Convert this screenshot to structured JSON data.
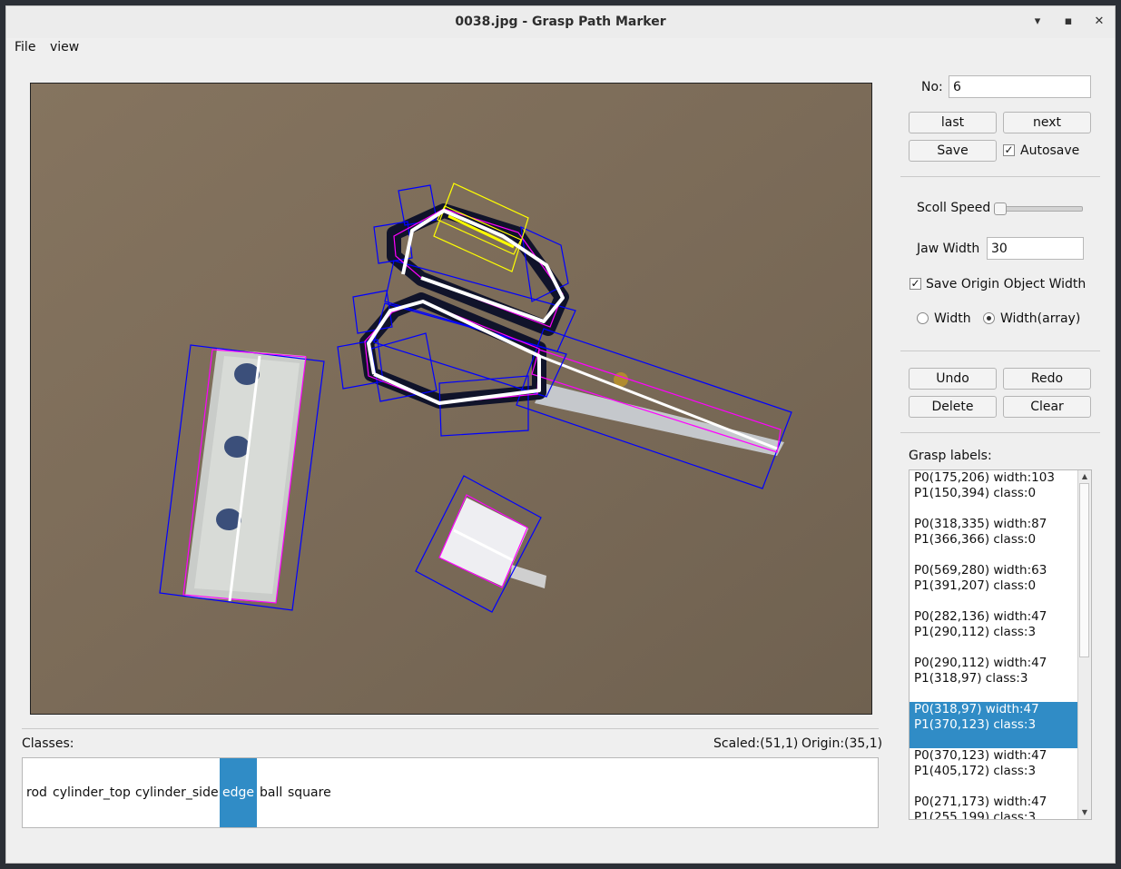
{
  "window": {
    "title": "0038.jpg - Grasp Path Marker",
    "minimize": "▾",
    "maximize": "▪",
    "close": "✕"
  },
  "menu": {
    "file": "File",
    "view": "view"
  },
  "controls": {
    "no_label": "No:",
    "no_value": "6",
    "last": "last",
    "next": "next",
    "save": "Save",
    "autosave": "Autosave",
    "autosave_checked": true,
    "scroll_speed": "Scoll Speed",
    "jaw_width_label": "Jaw Width",
    "jaw_width_value": "30",
    "save_origin": "Save Origin Object Width",
    "save_origin_checked": true,
    "width": "Width",
    "width_array": "Width(array)",
    "width_mode": "Width(array)",
    "undo": "Undo",
    "redo": "Redo",
    "delete": "Delete",
    "clear": "Clear"
  },
  "status": {
    "classes_label": "Classes:",
    "scaled": "Scaled:(51,1)",
    "origin": "Origin:(35,1)"
  },
  "classes": [
    "rod",
    "cylinder_top",
    "cylinder_side",
    "edge",
    "ball",
    "square"
  ],
  "selected_class": "edge",
  "grasp_labels_title": "Grasp labels:",
  "grasp_labels": [
    {
      "line1": "P0(175,206) width:103",
      "line2": "P1(150,394) class:0"
    },
    {
      "line1": "P0(318,335) width:87",
      "line2": "P1(366,366) class:0"
    },
    {
      "line1": "P0(569,280) width:63",
      "line2": "P1(391,207) class:0"
    },
    {
      "line1": "P0(282,136) width:47",
      "line2": "P1(290,112) class:3"
    },
    {
      "line1": "P0(290,112) width:47",
      "line2": "P1(318,97) class:3"
    },
    {
      "line1": "P0(318,97) width:47",
      "line2": "P1(370,123) class:3"
    },
    {
      "line1": "P0(370,123) width:47",
      "line2": "P1(405,172) class:3"
    },
    {
      "line1": "P0(271,173) width:47",
      "line2": "P1(255,199) class:3"
    }
  ],
  "selected_grasp_index": 5,
  "colors": {
    "selection": "#308cc6",
    "grasp_box": "#0000ff",
    "object_box": "#ff00ff",
    "active_box": "#ffff00",
    "path": "#ffffff"
  }
}
